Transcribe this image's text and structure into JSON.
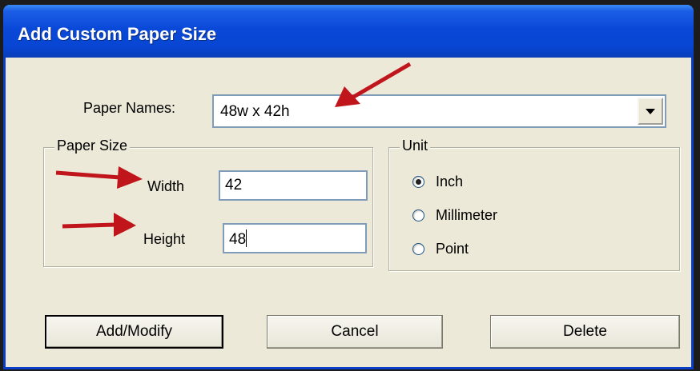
{
  "window": {
    "title": "Add Custom Paper Size"
  },
  "paper_names": {
    "label": "Paper Names:",
    "value": "48w x 42h"
  },
  "paper_size": {
    "legend": "Paper Size",
    "width_label": "Width",
    "width_value": "42",
    "height_label": "Height",
    "height_value": "48"
  },
  "unit": {
    "legend": "Unit",
    "options": [
      {
        "label": "Inch",
        "selected": true
      },
      {
        "label": "Millimeter",
        "selected": false
      },
      {
        "label": "Point",
        "selected": false
      }
    ]
  },
  "buttons": {
    "add_modify": "Add/Modify",
    "cancel": "Cancel",
    "delete": "Delete"
  },
  "colors": {
    "title_bar": "#0a49d8",
    "dialog_bg": "#ece9d8",
    "annotation_arrow": "#c0161b"
  }
}
